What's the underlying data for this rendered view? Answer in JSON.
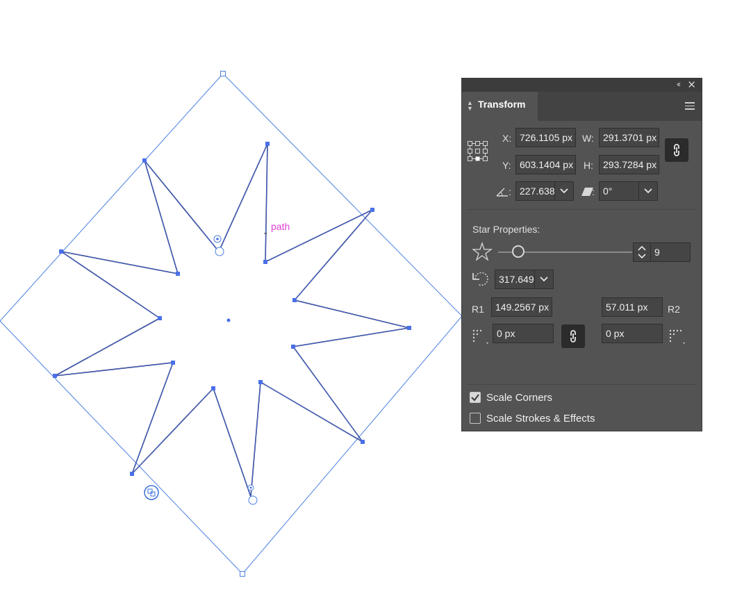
{
  "canvas": {
    "selection_label": "path",
    "accent_color": "#4a6fe8",
    "label_color": "#e040d8"
  },
  "panel": {
    "title": "Transform",
    "collapse_icon": "double-chevron-left-icon",
    "close_icon": "close-icon",
    "x_label": "X:",
    "x_value": "726.1105 px",
    "y_label": "Y:",
    "y_value": "603.1404 px",
    "w_label": "W:",
    "w_value": "291.3701 px",
    "h_label": "H:",
    "h_value": "293.7284 px",
    "rotate_colon": ":",
    "rotate_value": "227.638°",
    "shear_colon": ":",
    "shear_value": "0°",
    "star_properties_label": "Star Properties:",
    "points_value": "9",
    "star_rotation_value": "317.649°",
    "r1_label": "R1",
    "r1_value": "149.2567 px",
    "r2_label": "R2",
    "r2_value": "57.011 px",
    "corner_left_value": "0 px",
    "corner_right_value": "0 px",
    "scale_corners_label": "Scale Corners",
    "scale_corners_checked": true,
    "scale_strokes_label": "Scale Strokes & Effects",
    "scale_strokes_checked": false
  }
}
